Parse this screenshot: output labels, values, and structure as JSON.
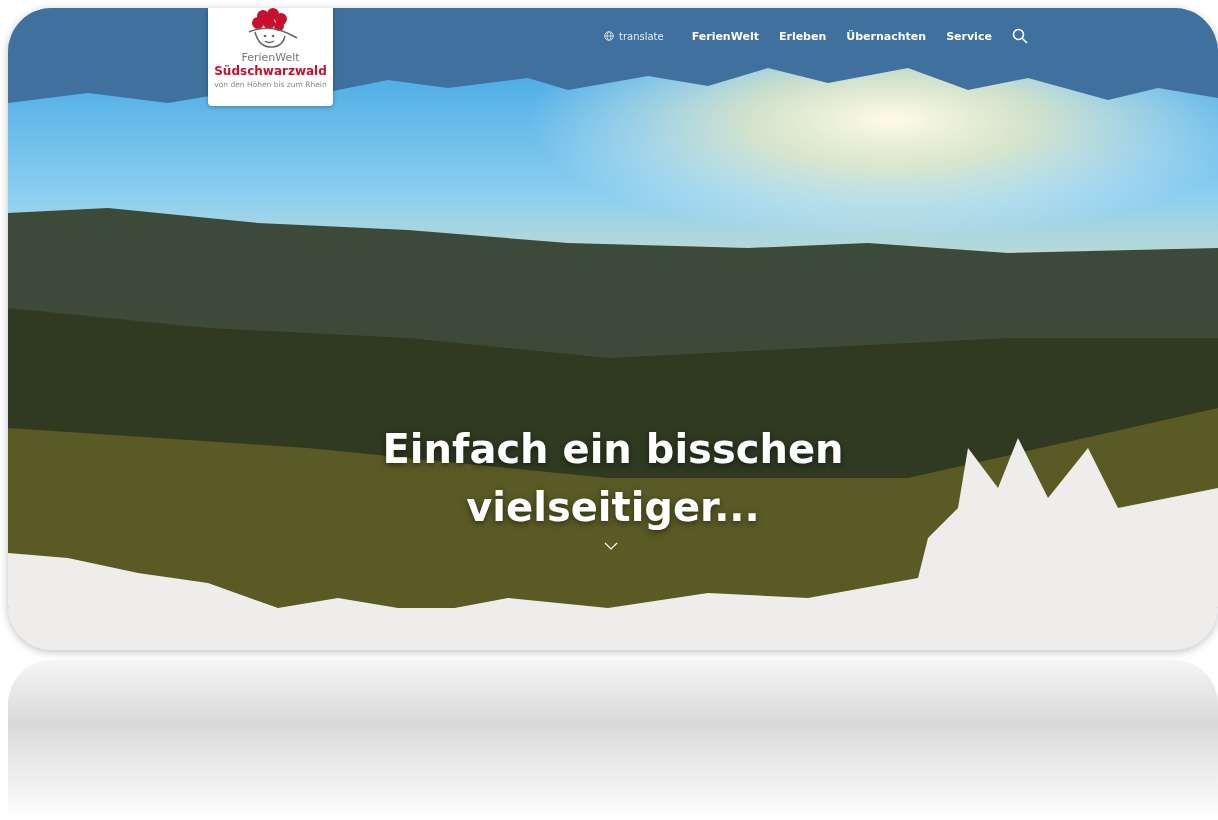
{
  "logo": {
    "line1": "FerienWelt",
    "line2": "Südschwarzwald",
    "tagline": "von den Höhen bis zum Rhein"
  },
  "nav": {
    "translate": "translate",
    "items": [
      {
        "label": "FerienWelt"
      },
      {
        "label": "Erleben"
      },
      {
        "label": "Übernachten"
      },
      {
        "label": "Service"
      }
    ]
  },
  "hero": {
    "headline_line1": "Einfach ein bisschen",
    "headline_line2": "vielseitiger..."
  }
}
